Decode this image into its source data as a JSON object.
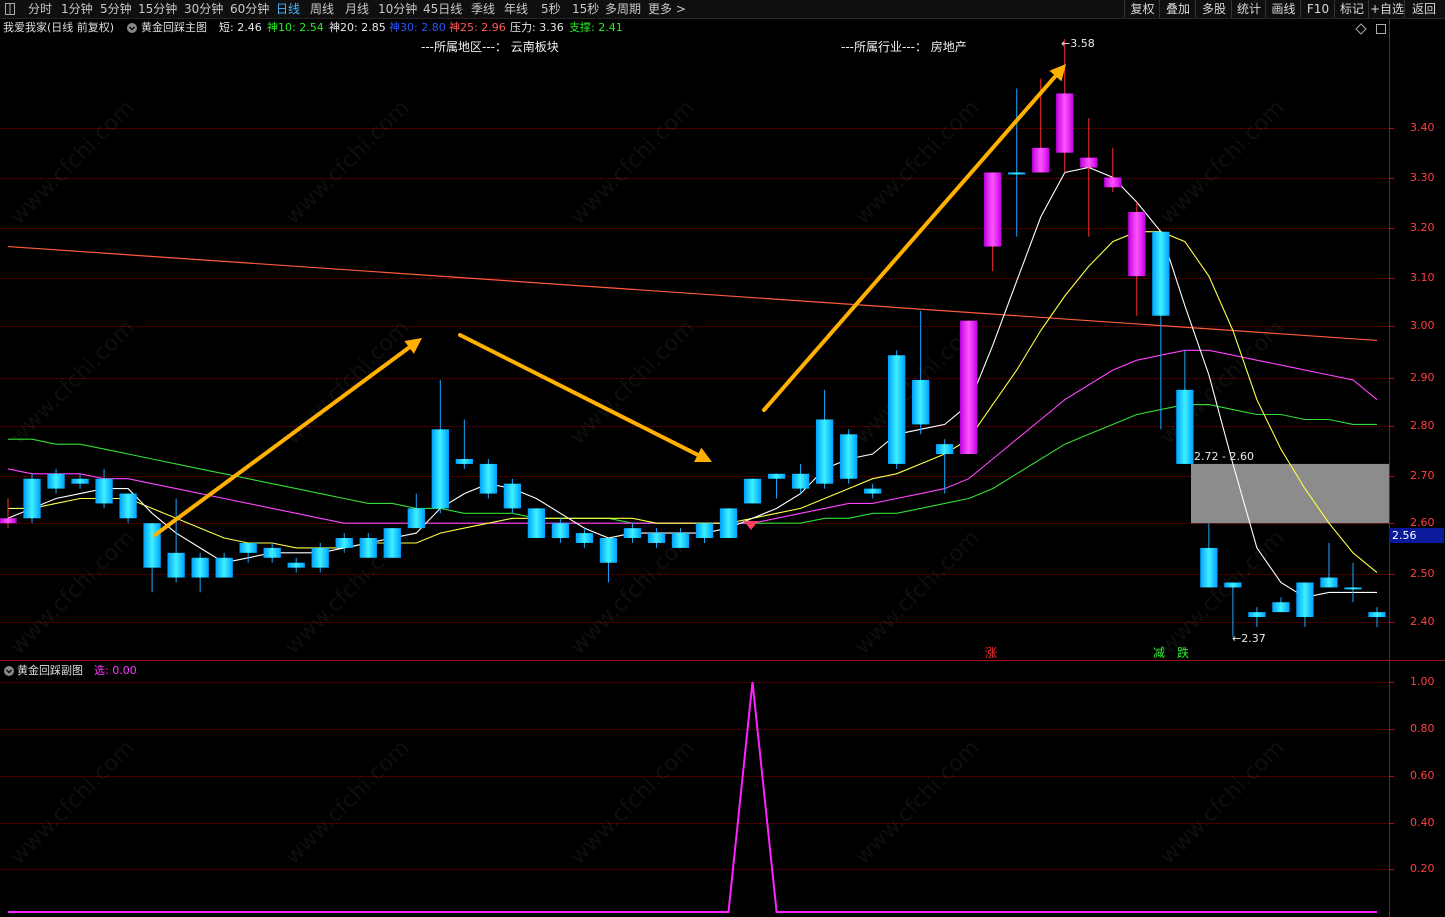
{
  "toolbar": {
    "left_icon": "window-icon",
    "periods": [
      "分时",
      "1分钟",
      "5分钟",
      "15分钟",
      "30分钟",
      "60分钟",
      "日线",
      "周线",
      "月线",
      "10分钟",
      "45日线",
      "季线",
      "年线",
      "5秒",
      "15秒",
      "多周期",
      "更多 >"
    ],
    "active_period": "日线",
    "right_buttons": [
      "复权",
      "叠加",
      "多股",
      "统计",
      "画线",
      "F10",
      "标记",
      "+自选",
      "返回"
    ]
  },
  "main_header": {
    "stock": "我爱我家(日线 前复权)",
    "indicator": "黄金回踩主图",
    "collapse_icon": "chevron-down-icon",
    "values": [
      {
        "label": "短:",
        "value": "2.46",
        "color": "#e8e8e8"
      },
      {
        "label": "神10:",
        "value": "2.54",
        "color": "#22ee22"
      },
      {
        "label": "神20:",
        "value": "2.85",
        "color": "#e8e8e8"
      },
      {
        "label": "神30:",
        "value": "2.80",
        "color": "#2b52ff"
      },
      {
        "label": "神25:",
        "value": "2.96",
        "color": "#ff5a5a"
      },
      {
        "label": "压力:",
        "value": "3.36",
        "color": "#e8e8e8"
      },
      {
        "label": "支撑:",
        "value": "2.41",
        "color": "#22ee22"
      }
    ],
    "region": "---所属地区---： 云南板块",
    "industry": "---所属行业---： 房地产",
    "settings_icon": "diamond-icon",
    "expand_icon": "square-icon"
  },
  "sub_header": {
    "indicator": "黄金回踩副图",
    "label": "选:",
    "value": "0.00",
    "collapse_icon": "chevron-down-icon"
  },
  "price_axis": {
    "labels": [
      "3.40",
      "3.30",
      "3.20",
      "3.10",
      "3.00",
      "2.90",
      "2.80",
      "2.70",
      "2.60",
      "2.50",
      "2.40"
    ],
    "current_price": "2.56"
  },
  "sub_axis": {
    "labels": [
      "1.00",
      "0.80",
      "0.60",
      "0.40",
      "0.20"
    ]
  },
  "annotations": {
    "high": "3.58",
    "low": "2.37",
    "box_range": "2.72 - 2.60",
    "signal_up": "涨",
    "signal_down1": "减",
    "signal_down2": "跌"
  },
  "watermark": "www.cfchi.com",
  "colors": {
    "up": "#00c8ff",
    "down": "#ff22ff",
    "wick": "#ff3030",
    "ma_short": "#ffffff",
    "ma_yellow": "#ffff44",
    "ma_magenta": "#ff44ff",
    "ma_green": "#33dd33",
    "pressure_line": "#ff5a3c",
    "arrow": "#ffb000",
    "signal_line": "#ff22ff"
  },
  "chart_data": {
    "type": "candlestick",
    "ylim": [
      2.33,
      3.62
    ],
    "candles": [
      {
        "o": 2.61,
        "h": 2.65,
        "l": 2.59,
        "c": 2.6
      },
      {
        "o": 2.61,
        "h": 2.7,
        "l": 2.6,
        "c": 2.69
      },
      {
        "o": 2.67,
        "h": 2.71,
        "l": 2.66,
        "c": 2.7
      },
      {
        "o": 2.68,
        "h": 2.7,
        "l": 2.67,
        "c": 2.69
      },
      {
        "o": 2.64,
        "h": 2.71,
        "l": 2.63,
        "c": 2.69
      },
      {
        "o": 2.61,
        "h": 2.66,
        "l": 2.6,
        "c": 2.66
      },
      {
        "o": 2.51,
        "h": 2.6,
        "l": 2.46,
        "c": 2.6
      },
      {
        "o": 2.49,
        "h": 2.65,
        "l": 2.48,
        "c": 2.54
      },
      {
        "o": 2.49,
        "h": 2.54,
        "l": 2.46,
        "c": 2.53
      },
      {
        "o": 2.49,
        "h": 2.54,
        "l": 2.49,
        "c": 2.53
      },
      {
        "o": 2.54,
        "h": 2.56,
        "l": 2.52,
        "c": 2.56
      },
      {
        "o": 2.53,
        "h": 2.56,
        "l": 2.52,
        "c": 2.55
      },
      {
        "o": 2.51,
        "h": 2.53,
        "l": 2.5,
        "c": 2.52
      },
      {
        "o": 2.51,
        "h": 2.56,
        "l": 2.5,
        "c": 2.55
      },
      {
        "o": 2.55,
        "h": 2.58,
        "l": 2.54,
        "c": 2.57
      },
      {
        "o": 2.53,
        "h": 2.58,
        "l": 2.53,
        "c": 2.57
      },
      {
        "o": 2.53,
        "h": 2.59,
        "l": 2.53,
        "c": 2.59
      },
      {
        "o": 2.59,
        "h": 2.66,
        "l": 2.59,
        "c": 2.63
      },
      {
        "o": 2.63,
        "h": 2.89,
        "l": 2.62,
        "c": 2.79
      },
      {
        "o": 2.72,
        "h": 2.81,
        "l": 2.71,
        "c": 2.73
      },
      {
        "o": 2.66,
        "h": 2.73,
        "l": 2.65,
        "c": 2.72
      },
      {
        "o": 2.63,
        "h": 2.69,
        "l": 2.62,
        "c": 2.68
      },
      {
        "o": 2.57,
        "h": 2.63,
        "l": 2.57,
        "c": 2.63
      },
      {
        "o": 2.57,
        "h": 2.61,
        "l": 2.56,
        "c": 2.6
      },
      {
        "o": 2.56,
        "h": 2.59,
        "l": 2.55,
        "c": 2.58
      },
      {
        "o": 2.52,
        "h": 2.57,
        "l": 2.48,
        "c": 2.57
      },
      {
        "o": 2.57,
        "h": 2.6,
        "l": 2.56,
        "c": 2.59
      },
      {
        "o": 2.56,
        "h": 2.59,
        "l": 2.55,
        "c": 2.58
      },
      {
        "o": 2.55,
        "h": 2.59,
        "l": 2.55,
        "c": 2.58
      },
      {
        "o": 2.57,
        "h": 2.6,
        "l": 2.56,
        "c": 2.6
      },
      {
        "o": 2.57,
        "h": 2.63,
        "l": 2.57,
        "c": 2.63
      },
      {
        "o": 2.64,
        "h": 2.69,
        "l": 2.64,
        "c": 2.69
      },
      {
        "o": 2.69,
        "h": 2.7,
        "l": 2.65,
        "c": 2.7
      },
      {
        "o": 2.67,
        "h": 2.72,
        "l": 2.66,
        "c": 2.7
      },
      {
        "o": 2.68,
        "h": 2.87,
        "l": 2.67,
        "c": 2.81
      },
      {
        "o": 2.69,
        "h": 2.79,
        "l": 2.68,
        "c": 2.78
      },
      {
        "o": 2.66,
        "h": 2.68,
        "l": 2.65,
        "c": 2.67
      },
      {
        "o": 2.72,
        "h": 2.95,
        "l": 2.71,
        "c": 2.94
      },
      {
        "o": 2.8,
        "h": 3.03,
        "l": 2.78,
        "c": 2.89
      },
      {
        "o": 2.74,
        "h": 2.77,
        "l": 2.66,
        "c": 2.76
      },
      {
        "o": 3.01,
        "h": 3.01,
        "l": 2.74,
        "c": 2.74
      },
      {
        "o": 3.31,
        "h": 3.31,
        "l": 3.11,
        "c": 3.16
      },
      {
        "o": 3.31,
        "h": 3.48,
        "l": 3.18,
        "c": 3.31
      },
      {
        "o": 3.36,
        "h": 3.5,
        "l": 3.31,
        "c": 3.31
      },
      {
        "o": 3.47,
        "h": 3.58,
        "l": 3.31,
        "c": 3.35
      },
      {
        "o": 3.34,
        "h": 3.42,
        "l": 3.18,
        "c": 3.32
      },
      {
        "o": 3.3,
        "h": 3.36,
        "l": 3.27,
        "c": 3.28
      },
      {
        "o": 3.23,
        "h": 3.25,
        "l": 3.02,
        "c": 3.1
      },
      {
        "o": 3.02,
        "h": 3.19,
        "l": 2.79,
        "c": 3.19
      },
      {
        "o": 2.72,
        "h": 2.95,
        "l": 2.72,
        "c": 2.87
      },
      {
        "o": 2.47,
        "h": 2.6,
        "l": 2.47,
        "c": 2.55
      },
      {
        "o": 2.47,
        "h": 2.48,
        "l": 2.37,
        "c": 2.48
      },
      {
        "o": 2.41,
        "h": 2.43,
        "l": 2.39,
        "c": 2.42
      },
      {
        "o": 2.42,
        "h": 2.45,
        "l": 2.42,
        "c": 2.44
      },
      {
        "o": 2.41,
        "h": 2.48,
        "l": 2.39,
        "c": 2.48
      },
      {
        "o": 2.47,
        "h": 2.56,
        "l": 2.47,
        "c": 2.49
      },
      {
        "o": 2.47,
        "h": 2.52,
        "l": 2.44,
        "c": 2.47
      },
      {
        "o": 2.41,
        "h": 2.43,
        "l": 2.39,
        "c": 2.42
      }
    ],
    "ma_short": [
      2.61,
      2.63,
      2.65,
      2.66,
      2.67,
      2.67,
      2.62,
      2.58,
      2.55,
      2.52,
      2.53,
      2.54,
      2.54,
      2.54,
      2.55,
      2.56,
      2.57,
      2.58,
      2.63,
      2.66,
      2.68,
      2.67,
      2.65,
      2.62,
      2.59,
      2.57,
      2.58,
      2.58,
      2.58,
      2.58,
      2.59,
      2.61,
      2.63,
      2.66,
      2.71,
      2.73,
      2.74,
      2.78,
      2.79,
      2.8,
      2.84,
      2.96,
      3.09,
      3.22,
      3.31,
      3.32,
      3.3,
      3.25,
      3.19,
      3.04,
      2.9,
      2.72,
      2.55,
      2.48,
      2.45,
      2.46,
      2.46,
      2.46
    ],
    "ma_yellow": [
      2.63,
      2.63,
      2.64,
      2.65,
      2.65,
      2.65,
      2.63,
      2.61,
      2.59,
      2.57,
      2.56,
      2.56,
      2.55,
      2.55,
      2.55,
      2.56,
      2.56,
      2.56,
      2.58,
      2.59,
      2.6,
      2.61,
      2.61,
      2.61,
      2.61,
      2.61,
      2.61,
      2.6,
      2.6,
      2.6,
      2.6,
      2.61,
      2.62,
      2.63,
      2.65,
      2.67,
      2.69,
      2.7,
      2.72,
      2.74,
      2.77,
      2.84,
      2.91,
      2.99,
      3.06,
      3.12,
      3.17,
      3.19,
      3.19,
      3.17,
      3.1,
      2.99,
      2.85,
      2.75,
      2.67,
      2.6,
      2.54,
      2.5
    ],
    "ma_magenta": [
      2.71,
      2.7,
      2.7,
      2.7,
      2.69,
      2.69,
      2.68,
      2.67,
      2.66,
      2.65,
      2.64,
      2.63,
      2.62,
      2.61,
      2.6,
      2.6,
      2.6,
      2.6,
      2.6,
      2.6,
      2.6,
      2.6,
      2.6,
      2.6,
      2.6,
      2.6,
      2.6,
      2.6,
      2.6,
      2.6,
      2.6,
      2.6,
      2.61,
      2.62,
      2.63,
      2.64,
      2.64,
      2.65,
      2.66,
      2.67,
      2.69,
      2.73,
      2.77,
      2.81,
      2.85,
      2.88,
      2.91,
      2.93,
      2.94,
      2.95,
      2.95,
      2.94,
      2.93,
      2.92,
      2.91,
      2.9,
      2.89,
      2.85
    ],
    "ma_green": [
      2.77,
      2.77,
      2.76,
      2.76,
      2.75,
      2.74,
      2.73,
      2.72,
      2.71,
      2.7,
      2.69,
      2.68,
      2.67,
      2.66,
      2.65,
      2.64,
      2.64,
      2.63,
      2.63,
      2.62,
      2.62,
      2.62,
      2.61,
      2.61,
      2.61,
      2.61,
      2.6,
      2.6,
      2.6,
      2.6,
      2.6,
      2.6,
      2.6,
      2.6,
      2.61,
      2.61,
      2.62,
      2.62,
      2.63,
      2.64,
      2.65,
      2.67,
      2.7,
      2.73,
      2.76,
      2.78,
      2.8,
      2.82,
      2.83,
      2.84,
      2.84,
      2.83,
      2.82,
      2.82,
      2.81,
      2.81,
      2.8,
      2.8
    ],
    "pressure_line": {
      "start": 3.16,
      "end": 2.97
    },
    "support_box": {
      "top": 2.72,
      "bottom": 2.6
    },
    "sub_signal": {
      "ylim": [
        0,
        1.1
      ],
      "values": [
        0,
        0,
        0,
        0,
        0,
        0,
        0,
        0,
        0,
        0,
        0,
        0,
        0,
        0,
        0,
        0,
        0,
        0,
        0,
        0,
        0,
        0,
        0,
        0,
        0,
        0,
        0,
        0,
        0,
        0,
        0,
        1,
        0,
        0,
        0,
        0,
        0,
        0,
        0,
        0,
        0,
        0,
        0,
        0,
        0,
        0,
        0,
        0,
        0,
        0,
        0,
        0,
        0,
        0,
        0,
        0,
        0,
        0
      ]
    }
  }
}
